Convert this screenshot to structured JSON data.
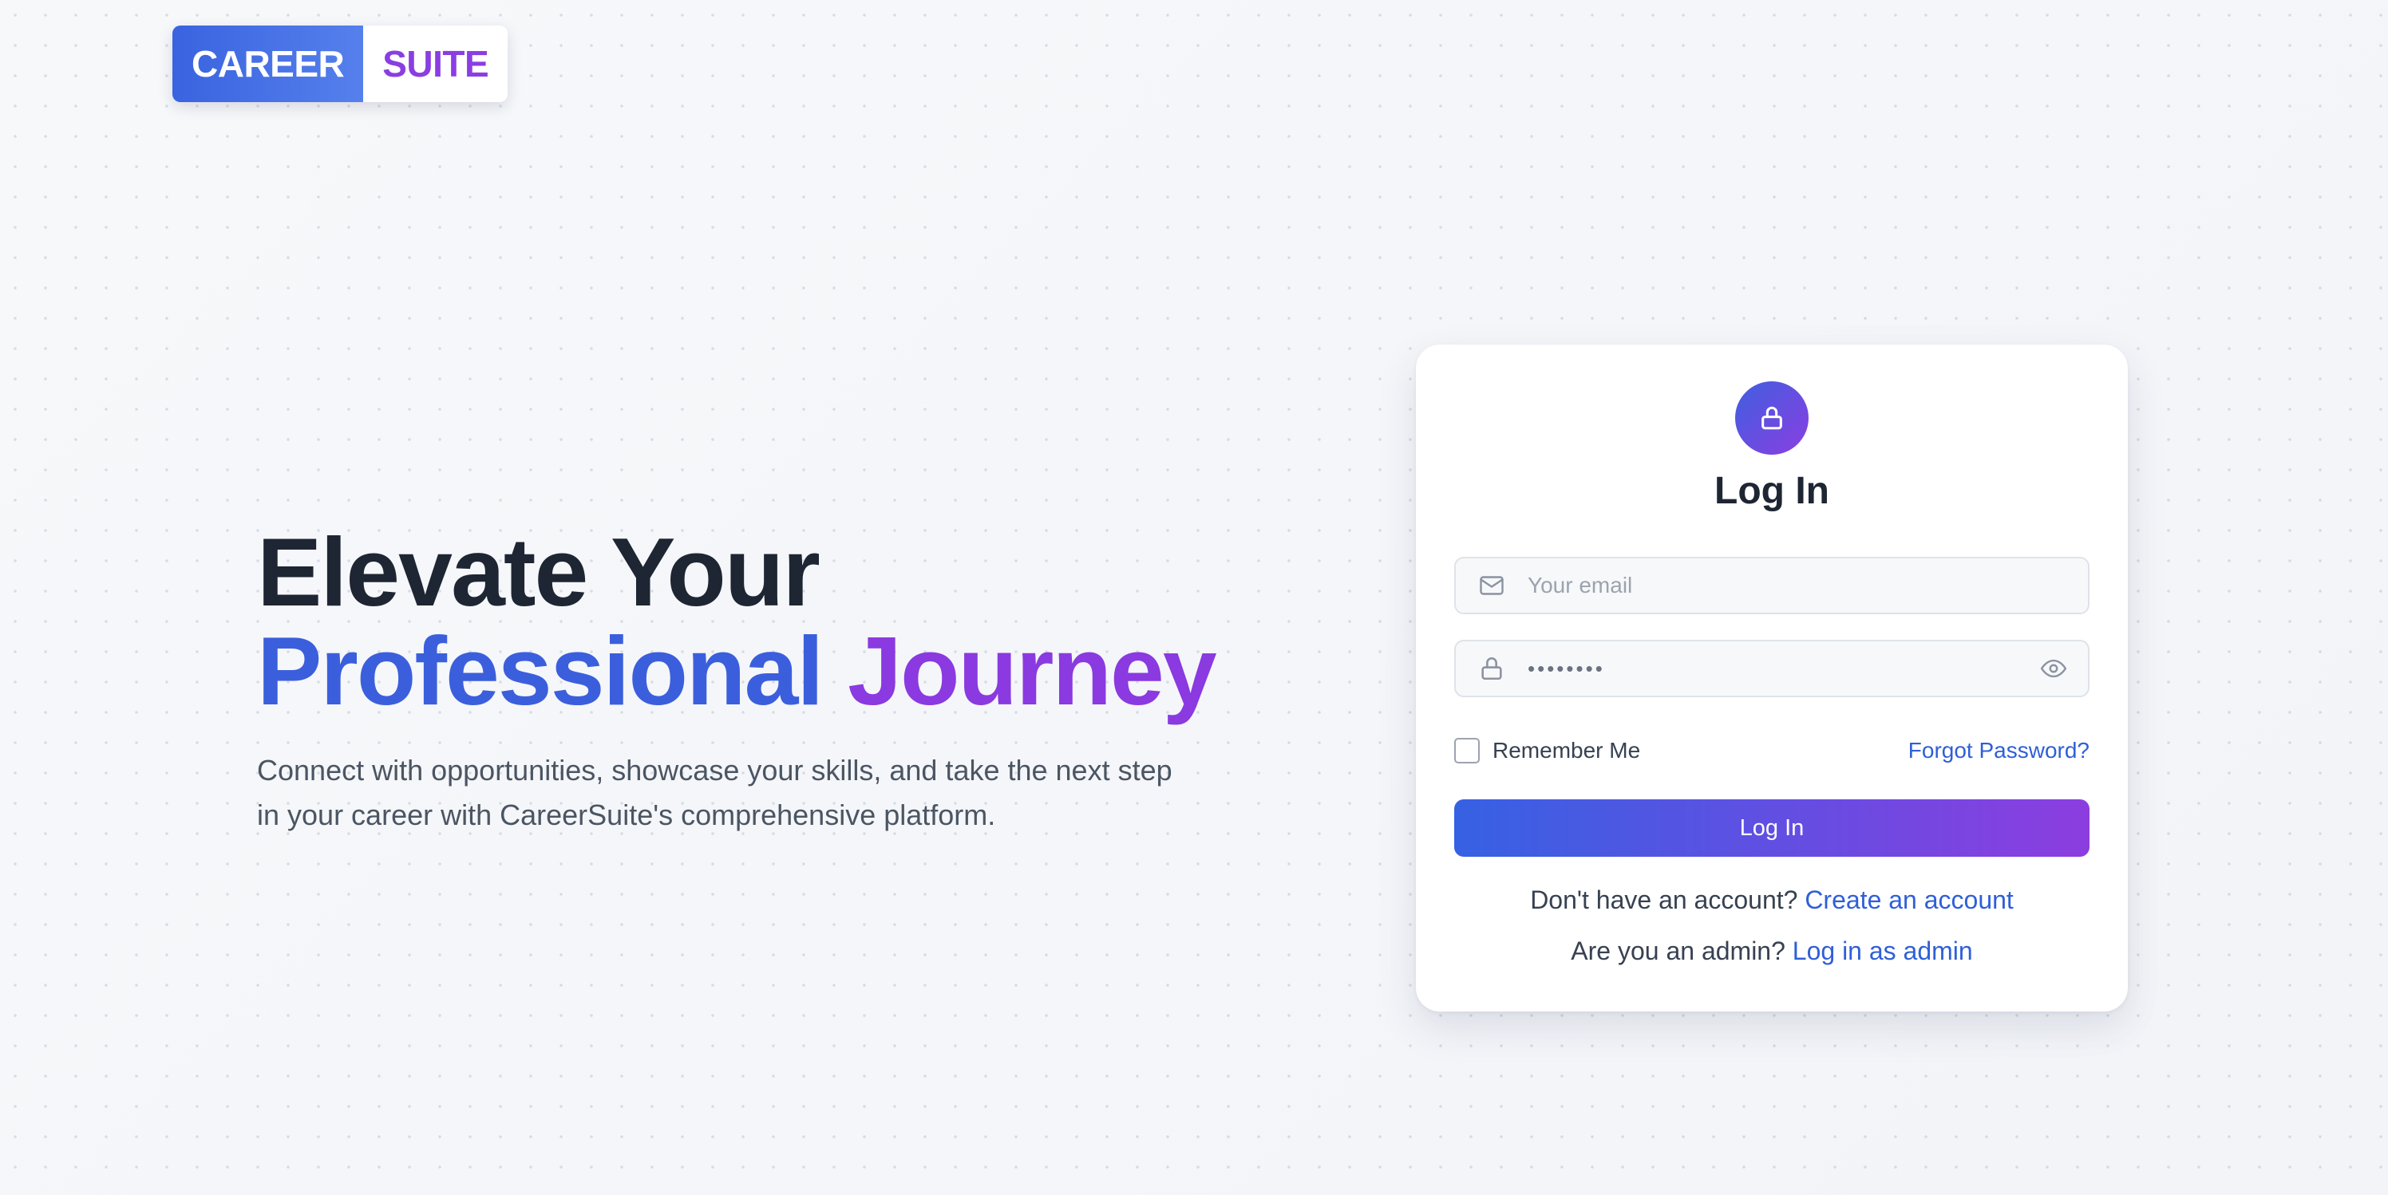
{
  "brand": {
    "left": "CAREER",
    "right": "SUITE",
    "colors": {
      "primary_blue": "#3b5fdc",
      "primary_purple": "#8a3ae0"
    }
  },
  "hero": {
    "line1": "Elevate Your",
    "line2_blue": "Professional",
    "line2_purple": "Journey",
    "description": "Connect with opportunities, showcase your skills, and take the next step in your career with CareerSuite's comprehensive platform."
  },
  "login": {
    "icon": "lock-icon",
    "title": "Log In",
    "email": {
      "placeholder": "Your email",
      "value": "",
      "icon": "mail-icon"
    },
    "password": {
      "value": "••••••••",
      "icon": "lock-icon",
      "toggle_icon": "eye-icon"
    },
    "remember_label": "Remember Me",
    "remember_checked": false,
    "forgot_label": "Forgot Password?",
    "submit_label": "Log In",
    "signup_prompt": "Don't have an account?",
    "signup_link": "Create an account",
    "admin_prompt": "Are you an admin?",
    "admin_link": "Log in as admin"
  }
}
